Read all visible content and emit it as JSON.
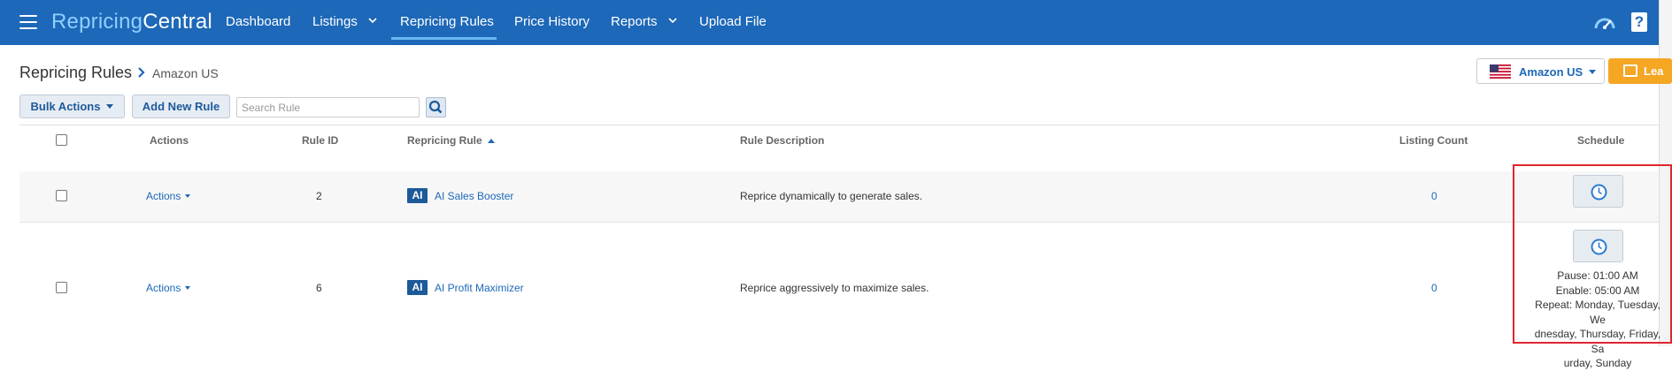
{
  "nav": {
    "brand_part1": "Repricing",
    "brand_part2": "Central",
    "items": [
      {
        "label": "Dashboard"
      },
      {
        "label": "Listings"
      },
      {
        "label": "Repricing Rules"
      },
      {
        "label": "Price History"
      },
      {
        "label": "Reports"
      },
      {
        "label": "Upload File"
      }
    ],
    "active": "Repricing Rules",
    "icons": [
      "menu-icon",
      "gauge-icon",
      "help-icon"
    ]
  },
  "header": {
    "title": "Repricing Rules",
    "breadcrumb_sub": "Amazon US",
    "marketplace": "Amazon US",
    "orange_button_partial": "Lea"
  },
  "toolbar": {
    "bulk_actions": "Bulk Actions",
    "add_new_rule": "Add New Rule",
    "search_placeholder": "Search Rule"
  },
  "table": {
    "columns": {
      "actions": "Actions",
      "rule_id": "Rule ID",
      "repricing_rule": "Repricing Rule",
      "rule_description": "Rule Description",
      "listing_count": "Listing Count",
      "schedule": "Schedule"
    },
    "sort": {
      "column": "Repricing Rule",
      "direction": "ascending"
    },
    "rows": [
      {
        "actions": "Actions",
        "rule_id": "2",
        "badge": "AI",
        "rule_name": "AI Sales Booster",
        "description": "Reprice dynamically to generate sales.",
        "listing_count": "0",
        "schedule_lines": []
      },
      {
        "actions": "Actions",
        "rule_id": "6",
        "badge": "AI",
        "rule_name": "AI Profit Maximizer",
        "description": "Reprice aggressively to maximize sales.",
        "listing_count": "0",
        "schedule_lines": [
          "Pause: 01:00 AM",
          "Enable: 05:00 AM",
          "Repeat: Monday, Tuesday, We",
          "dnesday, Thursday, Friday, Sa",
          "urday, Sunday"
        ]
      }
    ]
  },
  "colors": {
    "nav_bg": "#1d68b8",
    "accent_orange": "#f5a623",
    "highlight_red": "#e0262e",
    "link_blue": "#1d68b8"
  }
}
